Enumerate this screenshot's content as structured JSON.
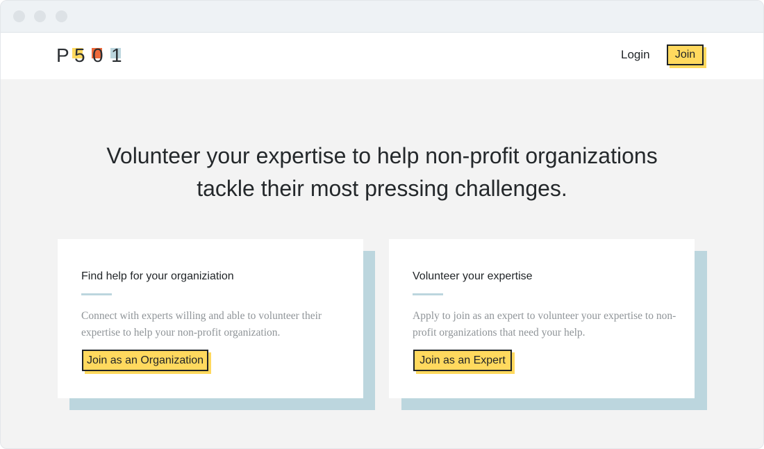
{
  "window": {
    "controls": [
      "close",
      "minimize",
      "maximize"
    ]
  },
  "header": {
    "logo": {
      "text": [
        "P",
        "5",
        "0",
        "1"
      ],
      "colors": [
        "#ffd95e",
        "#ef6a3c",
        "#bcd6de"
      ]
    },
    "login_label": "Login",
    "join_label": "Join"
  },
  "hero": {
    "line1": "Volunteer your expertise to help non-profit organizations",
    "line2": "tackle their most pressing challenges."
  },
  "cards": [
    {
      "title": "Find help for your organiziation",
      "text": "Connect with experts willing and able to volunteer their expertise to help your non-profit organization.",
      "button_label": "Join as an Organization"
    },
    {
      "title": "Volunteer your expertise",
      "text": "Apply to join as an expert to volunteer your expertise to non-profit organizations that need your help.",
      "button_label": "Join as an Expert"
    }
  ],
  "colors": {
    "accent_yellow": "#ffd95e",
    "accent_blue": "#bcd6de",
    "text_dark": "#1f2326",
    "text_muted": "#8f9498",
    "background": "#f3f3f3"
  }
}
